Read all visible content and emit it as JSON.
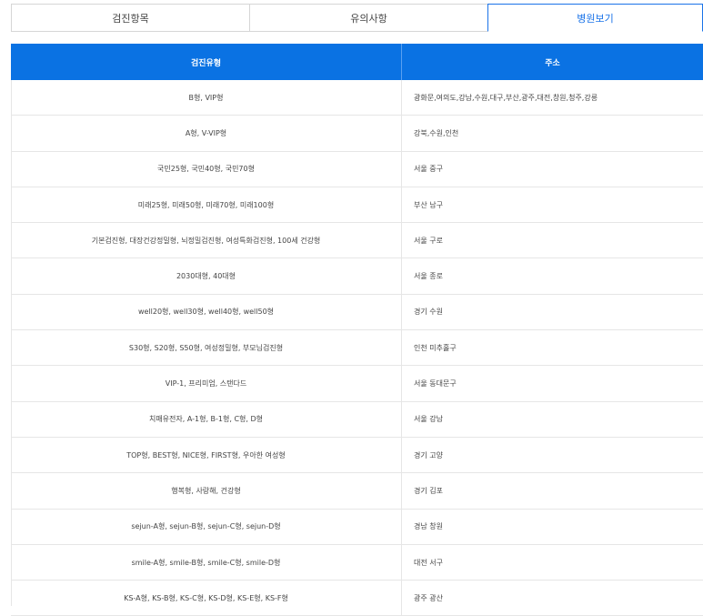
{
  "tabs": [
    {
      "label": "검진항목",
      "active": false
    },
    {
      "label": "유의사항",
      "active": false
    },
    {
      "label": "병원보기",
      "active": true
    }
  ],
  "table": {
    "headers": [
      "검진유형",
      "주소"
    ],
    "rows": [
      {
        "type": "B형, VIP형",
        "address": "광화문,여의도,강남,수원,대구,부산,광주,대전,창원,청주,강릉"
      },
      {
        "type": "A형, V-VIP형",
        "address": "강북,수원,인천"
      },
      {
        "type": "국민25형, 국민40형, 국민70형",
        "address": "서울 중구"
      },
      {
        "type": "미래25형, 미래50형, 미래70형, 미래100형",
        "address": "부산 남구"
      },
      {
        "type": "기본검진형, 대장건강정밀형, 뇌정밀검진형, 여성특화검진형, 100세 건강형",
        "address": "서울 구로"
      },
      {
        "type": "2030대형, 40대형",
        "address": "서울 종로"
      },
      {
        "type": "well20형, well30형, well40형, well50형",
        "address": "경기 수원"
      },
      {
        "type": "S30형, S20형, S50형, 여성정밀형, 부모님검진형",
        "address": "인천 미추홀구"
      },
      {
        "type": "VIP-1, 프리미엄, 스탠다드",
        "address": "서울 동대문구"
      },
      {
        "type": "치매유전자, A-1형, B-1형, C형, D형",
        "address": "서울 강남"
      },
      {
        "type": "TOP형, BEST형, NICE형, FIRST형, 우아한 여성형",
        "address": "경기 고양"
      },
      {
        "type": "행복형, 사랑해, 건강형",
        "address": "경기 김포"
      },
      {
        "type": "sejun-A형, sejun-B형, sejun-C형, sejun-D형",
        "address": "경남 창원"
      },
      {
        "type": "smile-A형, smile-B형, smile-C형, smile-D형",
        "address": "대전 서구"
      },
      {
        "type": "KS-A형, KS-B형, KS-C형, KS-D형, KS-E형, KS-F형",
        "address": "광주 광산"
      }
    ]
  },
  "colors": {
    "accent": "#0a72e3",
    "active_tab_border": "#1a73e8"
  }
}
